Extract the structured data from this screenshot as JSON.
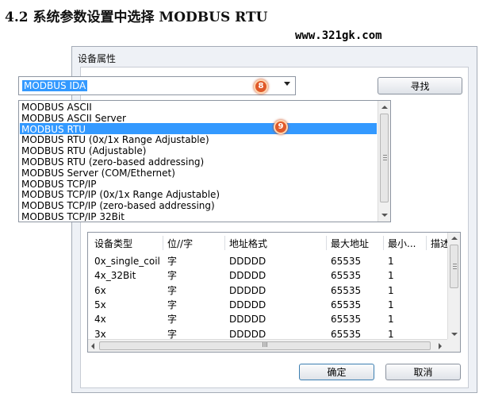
{
  "heading": "4.2 系统参数设置中选择 MODBUS RTU",
  "watermark": "www.321gk.com",
  "dialog": {
    "title": "设备属性",
    "combo_value": "MODBUS IDA",
    "find_button": "寻找",
    "ok_button": "确定",
    "cancel_button": "取消",
    "markers": [
      "8",
      "9"
    ]
  },
  "driver_list": {
    "items": [
      "MODBUS ASCII",
      "MODBUS ASCII Server",
      "MODBUS RTU",
      "MODBUS RTU (0x/1x Range Adjustable)",
      "MODBUS RTU (Adjustable)",
      "MODBUS RTU (zero-based addressing)",
      "MODBUS Server (COM/Ethernet)",
      "MODBUS TCP/IP",
      "MODBUS TCP/IP (0x/1x Range Adjustable)",
      "MODBUS TCP/IP (zero-based addressing)",
      "MODBUS TCP/IP 32Bit"
    ],
    "selected": "MODBUS RTU"
  },
  "device_table": {
    "columns": [
      "设备类型",
      "位//字",
      "地址格式",
      "最大地址",
      "最小...",
      "描述"
    ],
    "rows": [
      [
        "0x_single_coil",
        "字",
        "DDDDD",
        "65535",
        "1"
      ],
      [
        "4x_32Bit",
        "字",
        "DDDDD",
        "65535",
        "1"
      ],
      [
        "6x",
        "字",
        "DDDDD",
        "65535",
        "1"
      ],
      [
        "5x",
        "字",
        "DDDDD",
        "65535",
        "1"
      ],
      [
        "4x",
        "字",
        "DDDDD",
        "65535",
        "1"
      ],
      [
        "3x",
        "字",
        "DDDDD",
        "65535",
        "1"
      ]
    ],
    "hscroll_grip": "III"
  },
  "colors": {
    "selection": "#3399ff",
    "marker": "#e05a2a",
    "dialog_bg": "#eef1f6"
  }
}
